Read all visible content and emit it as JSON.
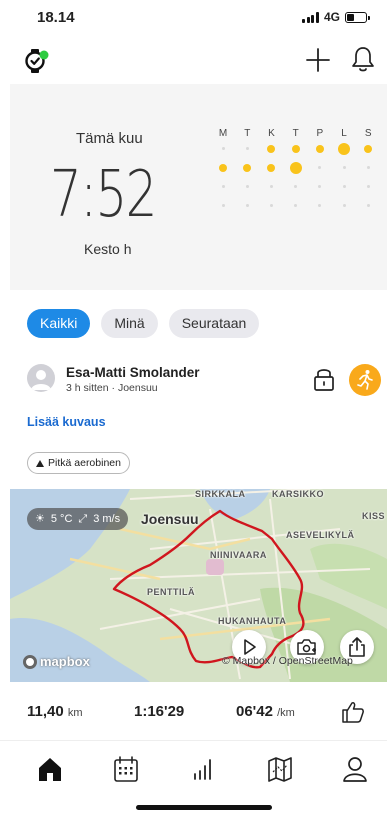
{
  "status_bar": {
    "time": "18.14",
    "network": "4G"
  },
  "summary": {
    "label": "Tämä kuu",
    "value": "7:52",
    "unit": "Kesto h",
    "days": [
      "M",
      "T",
      "K",
      "T",
      "P",
      "L",
      "S"
    ],
    "dots": [
      [
        0,
        0,
        2,
        2,
        2,
        3,
        2
      ],
      [
        2,
        2,
        2,
        3,
        0,
        0,
        0
      ],
      [
        0,
        0,
        0,
        0,
        0,
        0,
        0
      ],
      [
        0,
        0,
        0,
        0,
        0,
        0,
        0
      ]
    ],
    "dot_color": "#f9c31b"
  },
  "filters": [
    {
      "label": "Kaikki",
      "active": true
    },
    {
      "label": "Minä",
      "active": false
    },
    {
      "label": "Seurataan",
      "active": false
    }
  ],
  "post": {
    "author": "Esa-Matti Smolander",
    "meta": "3 h sitten · Joensuu",
    "add_description": "Lisää kuvaus",
    "tag": "Pitkä aerobinen",
    "sport_color": "#f9a91b"
  },
  "map": {
    "weather_temp": "5 °C",
    "weather_wind": "3 m/s",
    "city": "Joensuu",
    "labels": [
      "SIRKKALA",
      "KARSIKKO",
      "KISS",
      "ASEVELIKYLÄ",
      "NIINIVAARA",
      "PENTTILÄ",
      "HUKANHAUTA"
    ],
    "logo": "mapbox",
    "attribution": "© Mapbox / OpenStreetMap",
    "route_color": "#d0161e"
  },
  "stats": {
    "distance_value": "11,40",
    "distance_unit": "km",
    "duration": "1:16'29",
    "pace_value": "06'42",
    "pace_unit": "/km"
  },
  "tabs": [
    "home-icon",
    "calendar-icon",
    "progress-icon",
    "map-icon",
    "profile-icon"
  ]
}
